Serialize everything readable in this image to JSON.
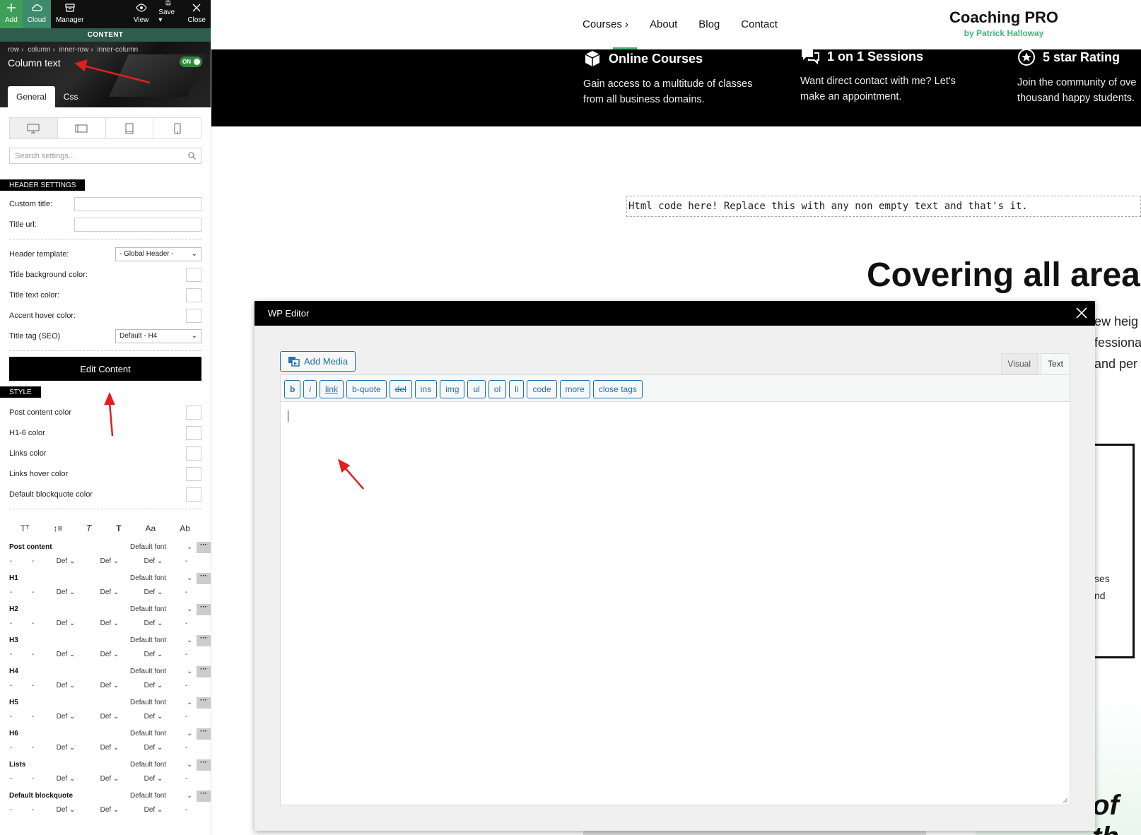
{
  "panel": {
    "toolbar": [
      {
        "label": "Add",
        "icon": "plus-icon"
      },
      {
        "label": "Cloud",
        "icon": "cloud-icon"
      },
      {
        "label": "Manager",
        "icon": "manager-icon"
      },
      {
        "label": "View",
        "icon": "eye-icon"
      },
      {
        "label": "Save ▾",
        "icon": "save-icon"
      },
      {
        "label": "Close",
        "icon": "close-icon"
      }
    ],
    "content_label": "CONTENT",
    "breadcrumb": [
      "row",
      "column",
      "inner-row",
      "inner-column"
    ],
    "breadcrumb_sep": "›",
    "title": "Column text",
    "toggle": "ON",
    "tabs": [
      "General",
      "Css"
    ],
    "search_placeholder": "Search settings...",
    "header_settings": {
      "label": "HEADER SETTINGS",
      "custom_title": "Custom title:",
      "title_url": "Title url:",
      "header_template": "Header template:",
      "header_template_value": "- Global Header -",
      "title_bg": "Title background color:",
      "title_text": "Title text color:",
      "accent_hover": "Accent hover color:",
      "title_tag": "Title tag (SEO)",
      "title_tag_value": "Default - H4"
    },
    "edit_content": "Edit Content",
    "style": {
      "label": "STYLE",
      "items": [
        "Post content color",
        "H1-6 color",
        "Links color",
        "Links hover color",
        "Default blockquote color"
      ]
    },
    "typo_icons": [
      "Tᵀ",
      "↕≡",
      "𝑇",
      "T",
      "Aa",
      "Ab"
    ],
    "font_rows": [
      {
        "name": "Post content"
      },
      {
        "name": "H1"
      },
      {
        "name": "H2"
      },
      {
        "name": "H3"
      },
      {
        "name": "H4"
      },
      {
        "name": "H5"
      },
      {
        "name": "H6"
      },
      {
        "name": "Lists"
      },
      {
        "name": "Default blockquote"
      }
    ],
    "font_value": "Default font",
    "dash": "-",
    "def": "Def"
  },
  "site": {
    "nav": [
      "Courses ›",
      "About",
      "Blog",
      "Contact"
    ],
    "brand_title": "Coaching PRO",
    "brand_sub": "by Patrick Halloway",
    "features": [
      {
        "title": "Online Courses",
        "text": "Gain access to a multitude of classes from all business domains."
      },
      {
        "title": "1 on 1 Sessions",
        "text": "Want direct contact with me? Let's make an appointment."
      },
      {
        "title": "5 star Rating",
        "text": "Join the community of ove thousand happy students."
      }
    ],
    "html_placeholder": "Html code here! Replace this with any non empty text and that's it.",
    "heading": "Covering all areas",
    "side_lines": [
      "ew heig",
      "fessiona",
      "and per"
    ],
    "small_lines": [
      "ses",
      "nd"
    ],
    "italic_text": "of th"
  },
  "modal": {
    "title": "WP Editor",
    "add_media": "Add Media",
    "tab_visual": "Visual",
    "tab_text": "Text",
    "quicktags": [
      "b",
      "i",
      "link",
      "b-quote",
      "del",
      "ins",
      "img",
      "ul",
      "ol",
      "li",
      "code",
      "more",
      "close tags"
    ]
  },
  "colors": {
    "accent_green": "#3fb97b",
    "toggle_green": "#2e8b3a",
    "annotation_red": "#e02020",
    "link_blue": "#2271b1"
  }
}
